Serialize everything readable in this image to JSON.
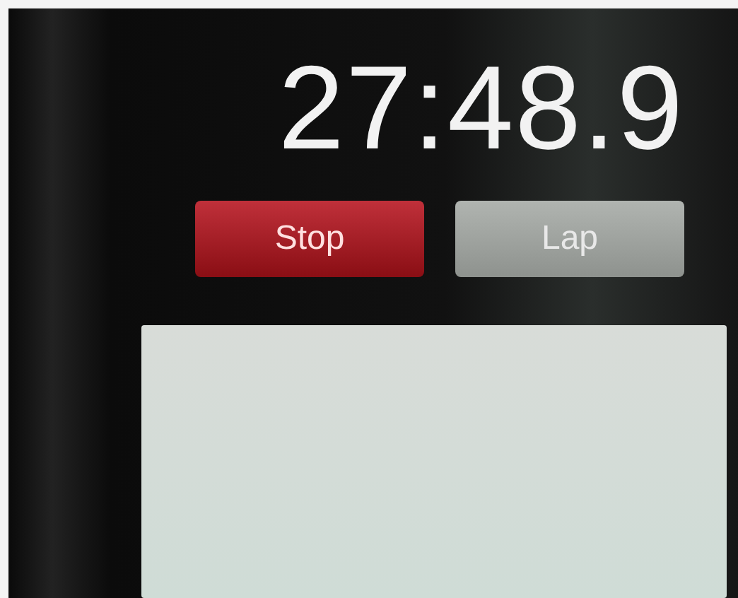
{
  "stopwatch": {
    "time": "27:48.9"
  },
  "buttons": [
    {
      "label": "Stop",
      "kind": "stop"
    },
    {
      "label": "Lap",
      "kind": "lap"
    }
  ],
  "laps": {
    "kind": "list"
  }
}
